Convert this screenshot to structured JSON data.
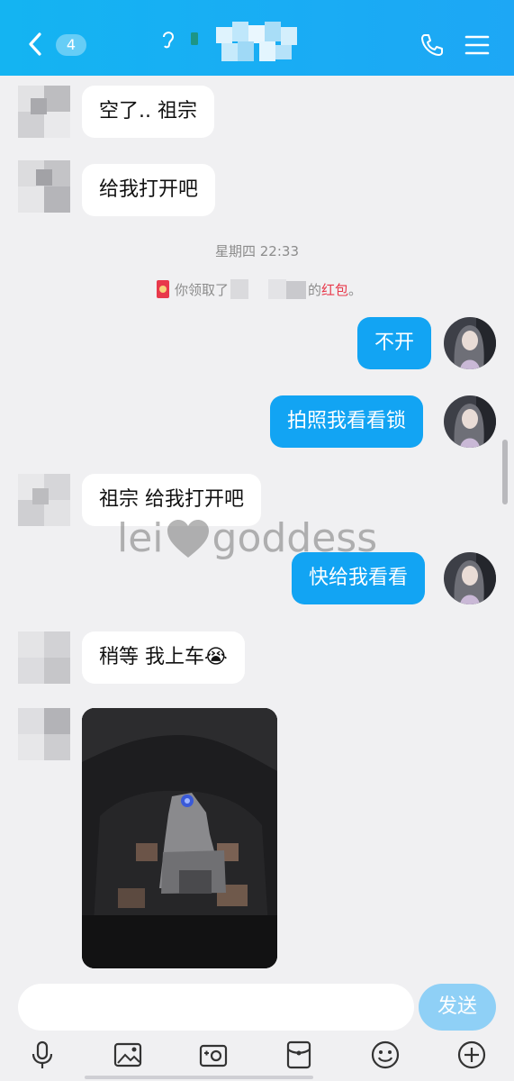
{
  "header": {
    "unread_count": "4",
    "colors": {
      "accent": "#14b4f2",
      "bubble_out": "#12a4f3",
      "send_button": "#8fd0f6",
      "redpacket": "#e8394b"
    }
  },
  "messages": {
    "m1": "空了.. 祖宗",
    "m2": "给我打开吧",
    "timestamp": "星期四 22:33",
    "redpacket_prefix": "你领取了",
    "redpacket_suffix": "的",
    "redpacket_link": "红包",
    "redpacket_end": "。",
    "m3": "不开",
    "m4": "拍照我看看锁",
    "m5": "祖宗 给我打开吧",
    "m6": "快给我看看",
    "m7": "稍等 我上车😭"
  },
  "watermark": {
    "left": "lei",
    "right": "goddess"
  },
  "input": {
    "placeholder": "",
    "send_label": "发送"
  },
  "toolbar": {
    "icons": [
      "microphone-icon",
      "image-icon",
      "camera-icon",
      "redpacket-icon",
      "emoji-icon",
      "plus-icon"
    ]
  }
}
